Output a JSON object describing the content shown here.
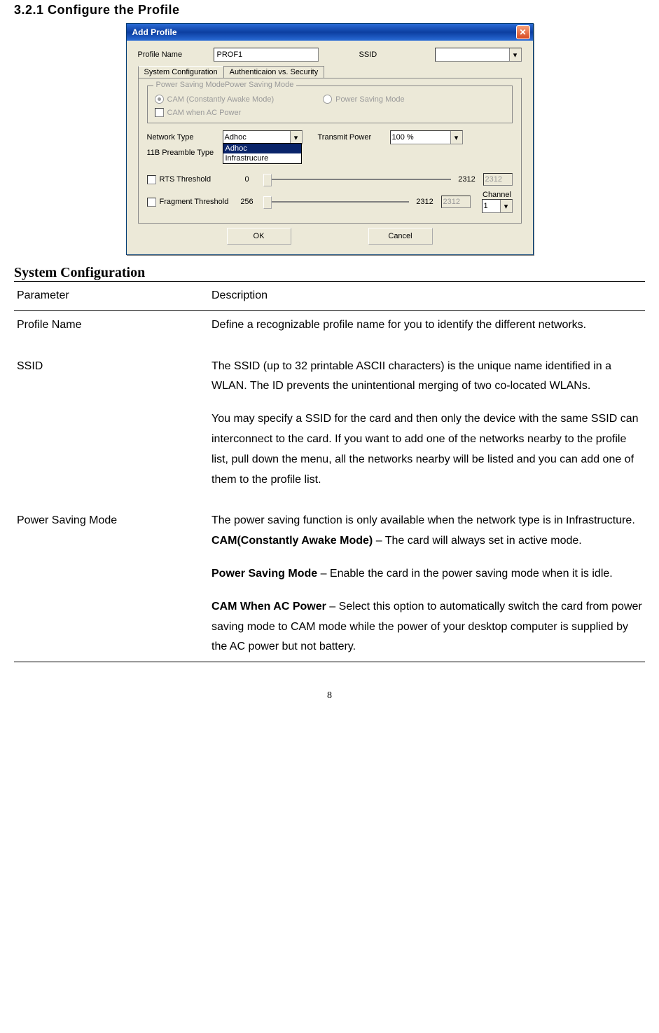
{
  "section_heading": "3.2.1   Configure the Profile",
  "dialog": {
    "title": "Add Profile",
    "labels": {
      "profile_name": "Profile Name",
      "ssid": "SSID",
      "tab_sys": "System Configuration",
      "tab_auth": "Authenticaion vs. Security",
      "groupbox_title": "Power Saving ModePower Saving Mode",
      "radio_cam": "CAM (Constantly Awake Mode)",
      "radio_psm": "Power Saving Mode",
      "chk_camac": "CAM when AC Power",
      "network_type": "Network Type",
      "transmit_power": "Transmit Power",
      "preamble": "11B Preamble Type",
      "rts": "RTS Threshold",
      "frag": "Fragment Threshold",
      "channel": "Channel",
      "ok": "OK",
      "cancel": "Cancel"
    },
    "values": {
      "profile_name": "PROF1",
      "ssid": "",
      "network_type_selected": "Adhoc",
      "network_type_options": [
        "Adhoc",
        "Infrastrucure"
      ],
      "transmit_power": "100 %",
      "rts_min": "0",
      "rts_max": "2312",
      "rts_val": "2312",
      "frag_min": "256",
      "frag_max": "2312",
      "frag_val": "2312",
      "channel": "1"
    }
  },
  "sysconf_heading": "System Configuration",
  "table": {
    "head_param": "Parameter",
    "head_desc": "Description",
    "rows": [
      {
        "param": "Profile Name",
        "desc": "Define a recognizable profile name for you to identify the different networks."
      },
      {
        "param": "SSID",
        "desc_p1": "The SSID (up to 32 printable ASCII characters) is the unique name identified in a WLAN. The ID prevents the unintentional merging of two co-located WLANs.",
        "desc_p2": "You may specify a SSID for the card and then only the device with the same SSID can interconnect to the card. If you want to add one of the networks nearby to the profile list, pull down the menu, all the networks nearby will be listed and you can add one of them to the profile list."
      },
      {
        "param": "Power Saving Mode",
        "desc_intro": "The power saving function is only available when the network type is in Infrastructure.",
        "cam_bold": "CAM(Constantly Awake Mode)",
        "cam_rest": " – The card will always set in active mode.",
        "psm_bold": "Power Saving Mode",
        "psm_rest": " – Enable the card in the power saving mode when it is idle.",
        "camac_bold": "CAM When AC Power",
        "camac_rest": " – Select this option to automatically switch the card from power saving mode to CAM mode while the power of your desktop computer is supplied by the AC power but not battery."
      }
    ]
  },
  "page_number": "8"
}
